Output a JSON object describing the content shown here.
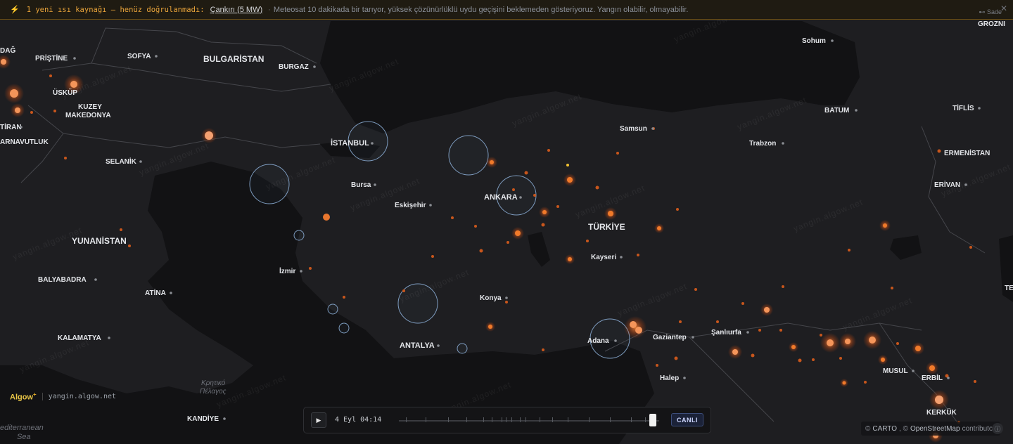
{
  "alert": {
    "icon": "bolt-icon",
    "lead": "1 yeni ısı kaynağı — henüz doğrulanmadı:",
    "place": "Çankırı (5 MW)",
    "separator": "·",
    "message": "Meteosat 10 dakikada bir tarıyor, yüksek çözünürlüklü uydu geçişini beklemeden gösteriyoruz. Yangın olabilir, olmayabilir.",
    "mode_label": "Sade",
    "close_label": "✕"
  },
  "brand": {
    "logo": "Algow",
    "logo_mark": "+",
    "url": "yangin.algow.net"
  },
  "watermark": "yangin.algow.net",
  "timeline": {
    "play_label": "▶",
    "time": "4 Eyl 04:14",
    "live_label": "CANLI",
    "position": 0.99
  },
  "attribution": {
    "prefix": "©",
    "carto": "CARTO",
    "osm_prefix": ", ©",
    "osm": "OpenStreetMap",
    "suffix": "contributors"
  },
  "colors": {
    "land": "#2a2a2d",
    "sea": "#141416",
    "border": "#4a4b50",
    "fire": "#f07a2a",
    "fire_glow": "#e55a1a",
    "satellite_ring": "#9fc1e6",
    "accent": "#e8a33a"
  },
  "labels": {
    "countries": [
      "BULGARİSTAN",
      "KUZEY",
      "MAKEDONYA",
      "YUNANİSTAN",
      "TÜRKİYE",
      "ERMENİSTAN",
      "ARNAVUTLUK"
    ],
    "cities": [
      "SOFYA",
      "BURGAZ",
      "PRİŞTİNE",
      "ÜSKÜP",
      "SELANİK",
      "İSTANBUL",
      "Bursa",
      "Eskişehir",
      "ANKARA",
      "Samsun",
      "Trabzon",
      "Sohum",
      "BATUM",
      "TİFLİS",
      "GROZNI",
      "ERİVAN",
      "Kayseri",
      "Konya",
      "İzmir",
      "ANTALYA",
      "Adana",
      "Gaziantep",
      "Şanlıurfa",
      "Halep",
      "MUSUL",
      "ERBİL",
      "KERKÜK",
      "ATİNA",
      "BALYABADRA",
      "KALAMATYA",
      "KANDİYE",
      "TİRAN",
      "DAĞ",
      "TE"
    ],
    "seas": [
      "Κρητικό",
      "Πέλαγος",
      "editerranean",
      "Sea"
    ]
  }
}
